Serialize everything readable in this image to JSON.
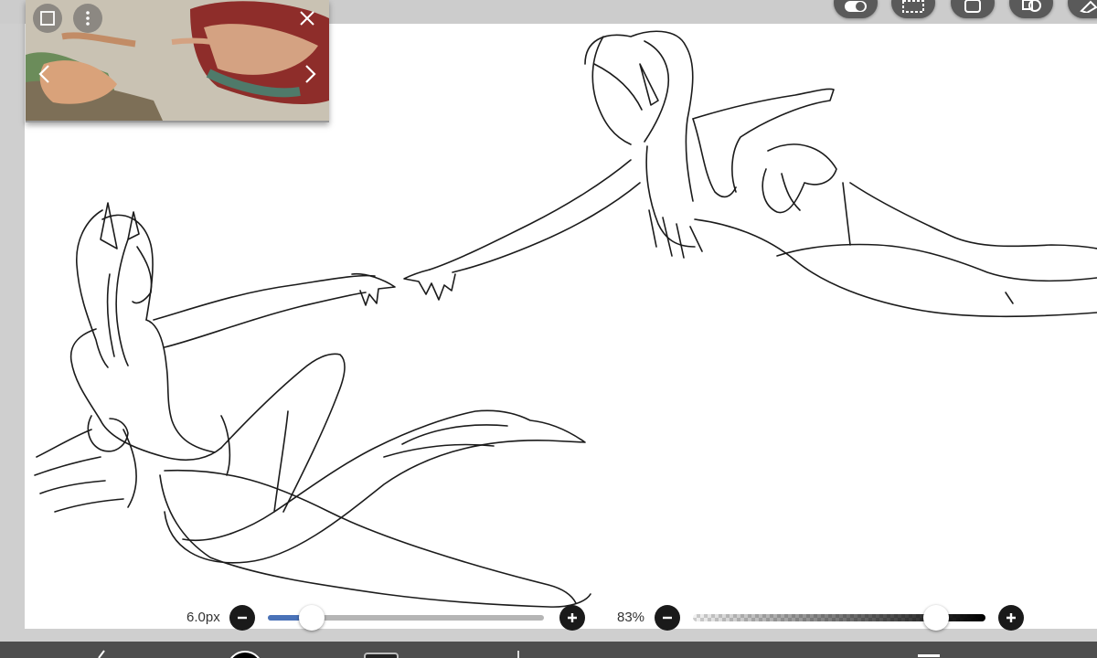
{
  "app": {
    "accent_color": "#4a72b8",
    "canvas_color": "#ffffff",
    "chrome_color": "#cfcfcf"
  },
  "top_toolbar": {
    "tools": [
      {
        "name": "toggle-icon"
      },
      {
        "name": "selection-icon"
      },
      {
        "name": "layer-icon"
      },
      {
        "name": "shape-icon"
      },
      {
        "name": "ruler-icon"
      }
    ]
  },
  "reference_window": {
    "image_description_icon": "painting-thumbnail",
    "controls": [
      "frame-icon",
      "more-vertical-icon",
      "close-icon",
      "chevron-left-icon",
      "chevron-right-icon"
    ]
  },
  "brush_size": {
    "label": "6.0px",
    "value_fraction": 0.16
  },
  "brush_opacity": {
    "label": "83%",
    "value_fraction": 0.83
  },
  "bottom_bar": {
    "items": [
      "undo-icon",
      "color-swatch",
      "layers-icon",
      "brush-icon",
      "menu-icon"
    ]
  }
}
